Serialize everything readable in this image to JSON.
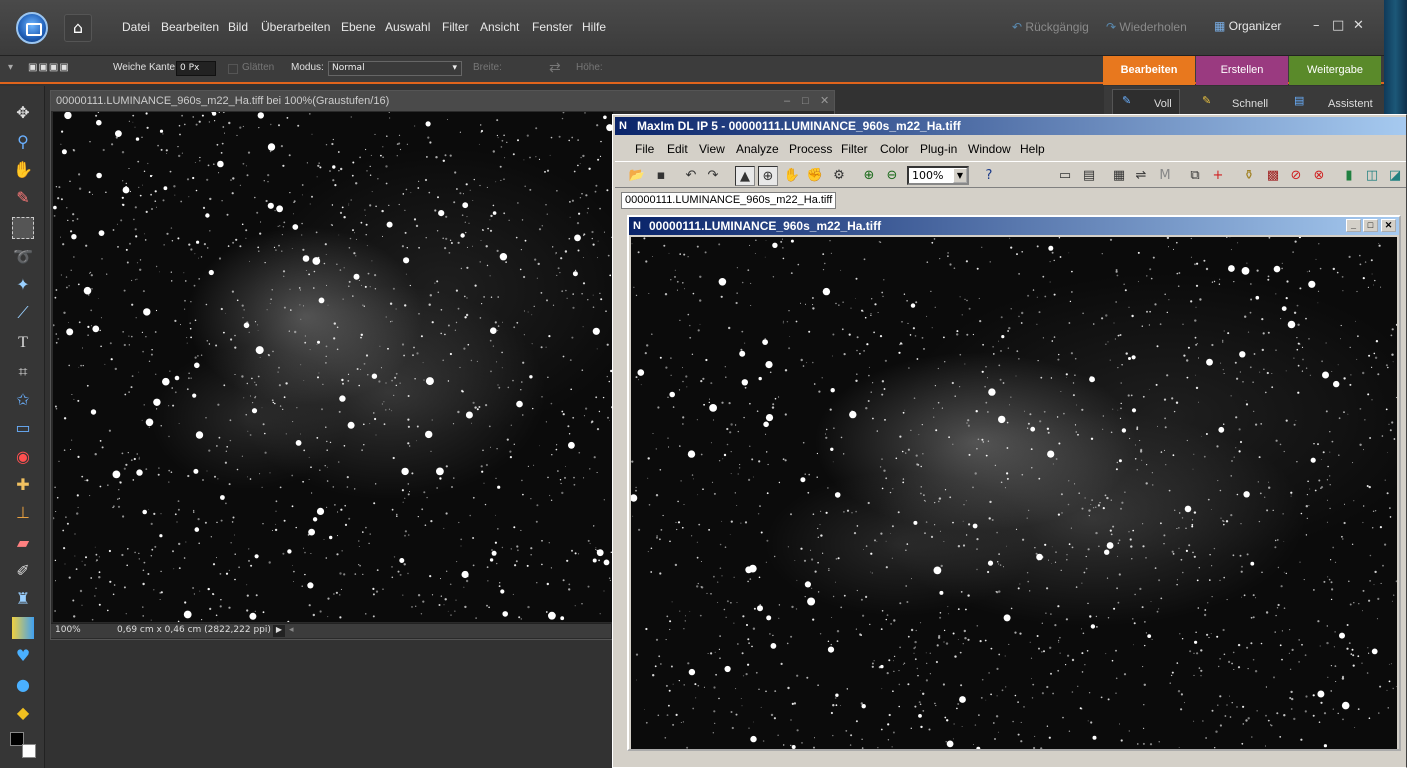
{
  "pse": {
    "menu": [
      "Datei",
      "Bearbeiten",
      "Bild",
      "Überarbeiten",
      "Ebene",
      "Auswahl",
      "Filter",
      "Ansicht",
      "Fenster",
      "Hilfe"
    ],
    "undo": "Rückgängig",
    "redo": "Wiederholen",
    "organizer": "Organizer",
    "options": {
      "feather_label": "Weiche Kante:",
      "feather_value": "0 Px",
      "smooth_label": "Glätten",
      "mode_label": "Modus:",
      "mode_value": "Normal",
      "width_label": "Breite:",
      "height_label": "Höhe:"
    },
    "tabs": [
      {
        "label": "Bearbeiten",
        "color": "#e8781e"
      },
      {
        "label": "Erstellen",
        "color": "#9a3a80"
      },
      {
        "label": "Weitergabe",
        "color": "#5a8a2a"
      }
    ],
    "edit_modes": [
      "Voll",
      "Schnell",
      "Assistent"
    ],
    "document": {
      "title": "00000111.LUMINANCE_960s_m22_Ha.tiff bei 100%(Graustufen/16)",
      "zoom": "100%",
      "size_info": "0,69 cm x 0,46 cm (2822,222 ppi)"
    }
  },
  "maxim": {
    "title": "MaxIm DL IP 5 - 00000111.LUMINANCE_960s_m22_Ha.tiff",
    "menu": [
      "File",
      "Edit",
      "View",
      "Analyze",
      "Process",
      "Filter",
      "Color",
      "Plug-in",
      "Window",
      "Help"
    ],
    "zoom": "100%",
    "doc_tab": "00000111.LUMINANCE_960s_m22_Ha.tiff",
    "child_title": "00000111.LUMINANCE_960s_m22_Ha.tiff"
  }
}
